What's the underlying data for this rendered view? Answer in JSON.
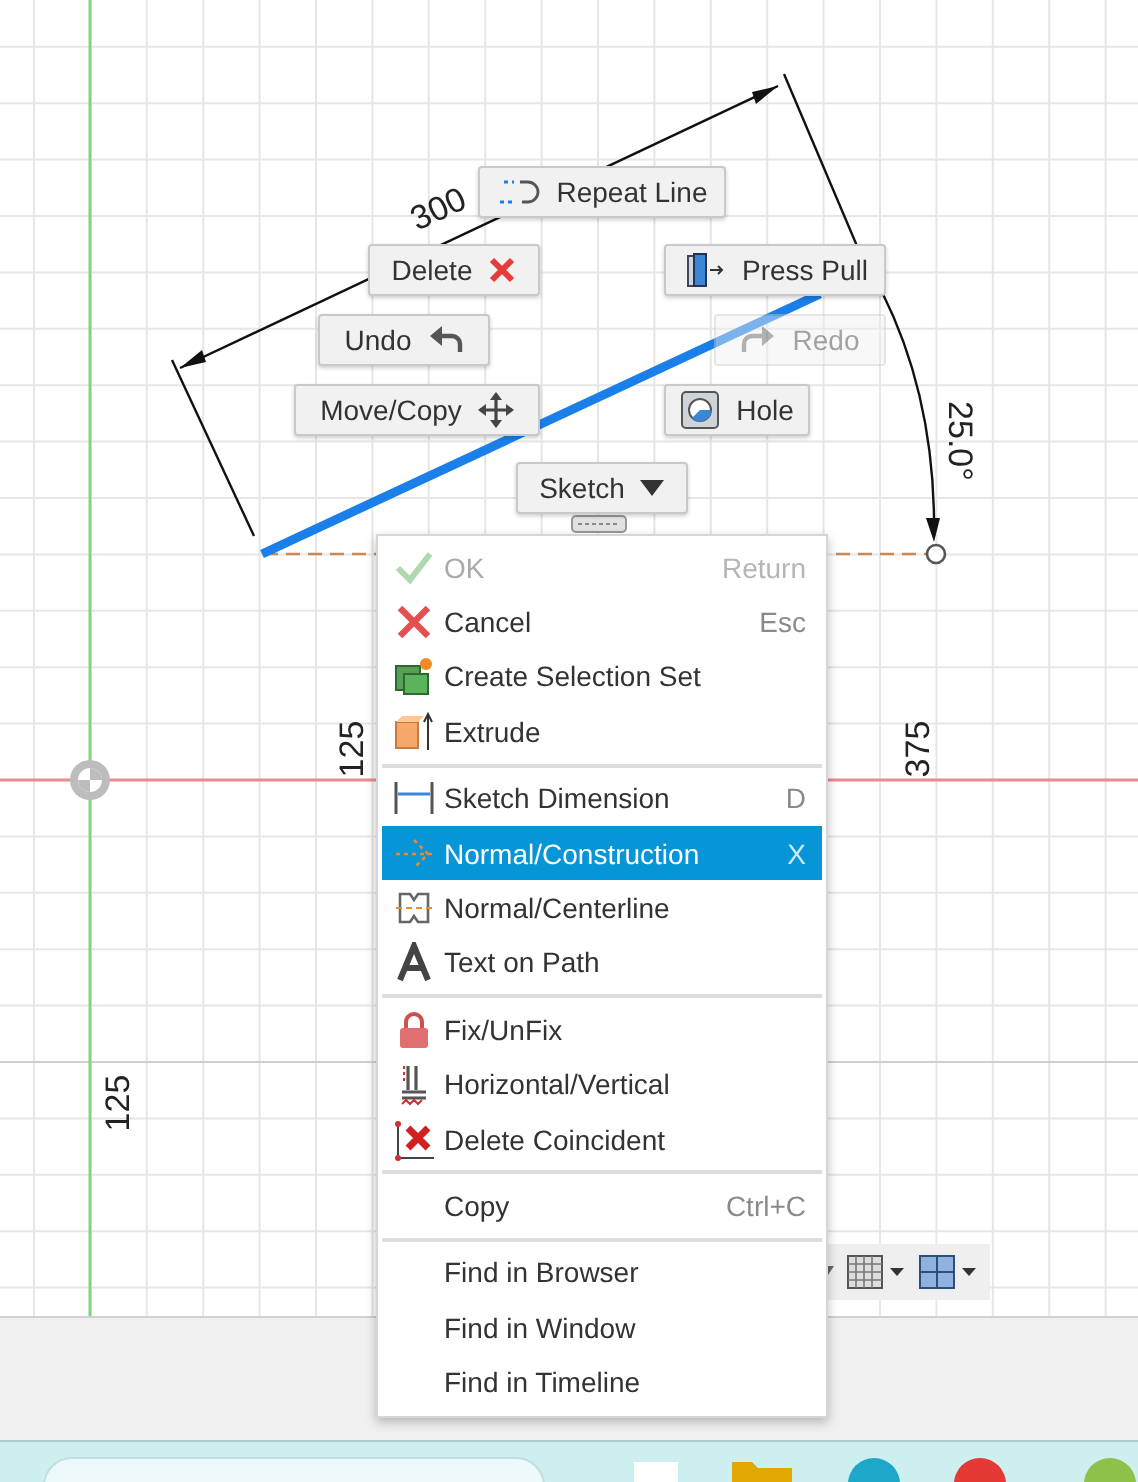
{
  "canvas": {
    "dimension_labels": [
      "300",
      "25.0°",
      "125",
      "375",
      "125"
    ]
  },
  "marking_menu": [
    {
      "label": "Repeat Line",
      "kind": "button",
      "disabled": false
    },
    {
      "label": "Delete",
      "kind": "button",
      "disabled": false
    },
    {
      "label": "Press Pull",
      "kind": "button",
      "disabled": false
    },
    {
      "label": "Undo",
      "kind": "button",
      "disabled": false
    },
    {
      "label": "Redo",
      "kind": "button",
      "disabled": true
    },
    {
      "label": "Move/Copy",
      "kind": "button",
      "disabled": false
    },
    {
      "label": "Hole",
      "kind": "button",
      "disabled": false
    },
    {
      "label": "Sketch",
      "kind": "dropdown",
      "disabled": false
    }
  ],
  "context_menu": {
    "sections": [
      [
        {
          "label": "OK",
          "shortcut": "Return",
          "disabled": true,
          "selected": false
        },
        {
          "label": "Cancel",
          "shortcut": "Esc",
          "disabled": false,
          "selected": false
        },
        {
          "label": "Create Selection Set",
          "disabled": false,
          "selected": false
        },
        {
          "label": "Extrude",
          "disabled": false,
          "selected": false
        }
      ],
      [
        {
          "label": "Sketch Dimension",
          "shortcut": "D",
          "disabled": false,
          "selected": false
        },
        {
          "label": "Normal/Construction",
          "shortcut": "X",
          "disabled": false,
          "selected": true
        },
        {
          "label": "Normal/Centerline",
          "disabled": false,
          "selected": false
        },
        {
          "label": "Text on Path",
          "disabled": false,
          "selected": false
        }
      ],
      [
        {
          "label": "Fix/UnFix",
          "disabled": false,
          "selected": false
        },
        {
          "label": "Horizontal/Vertical",
          "disabled": false,
          "selected": false
        },
        {
          "label": "Delete Coincident",
          "disabled": false,
          "selected": false
        }
      ],
      [
        {
          "label": "Copy",
          "shortcut": "Ctrl+C",
          "disabled": false,
          "selected": false
        }
      ],
      [
        {
          "label": "Find in Browser",
          "disabled": false,
          "selected": false
        },
        {
          "label": "Find in Window",
          "disabled": false,
          "selected": false
        },
        {
          "label": "Find in Timeline",
          "disabled": false,
          "selected": false
        }
      ]
    ]
  }
}
